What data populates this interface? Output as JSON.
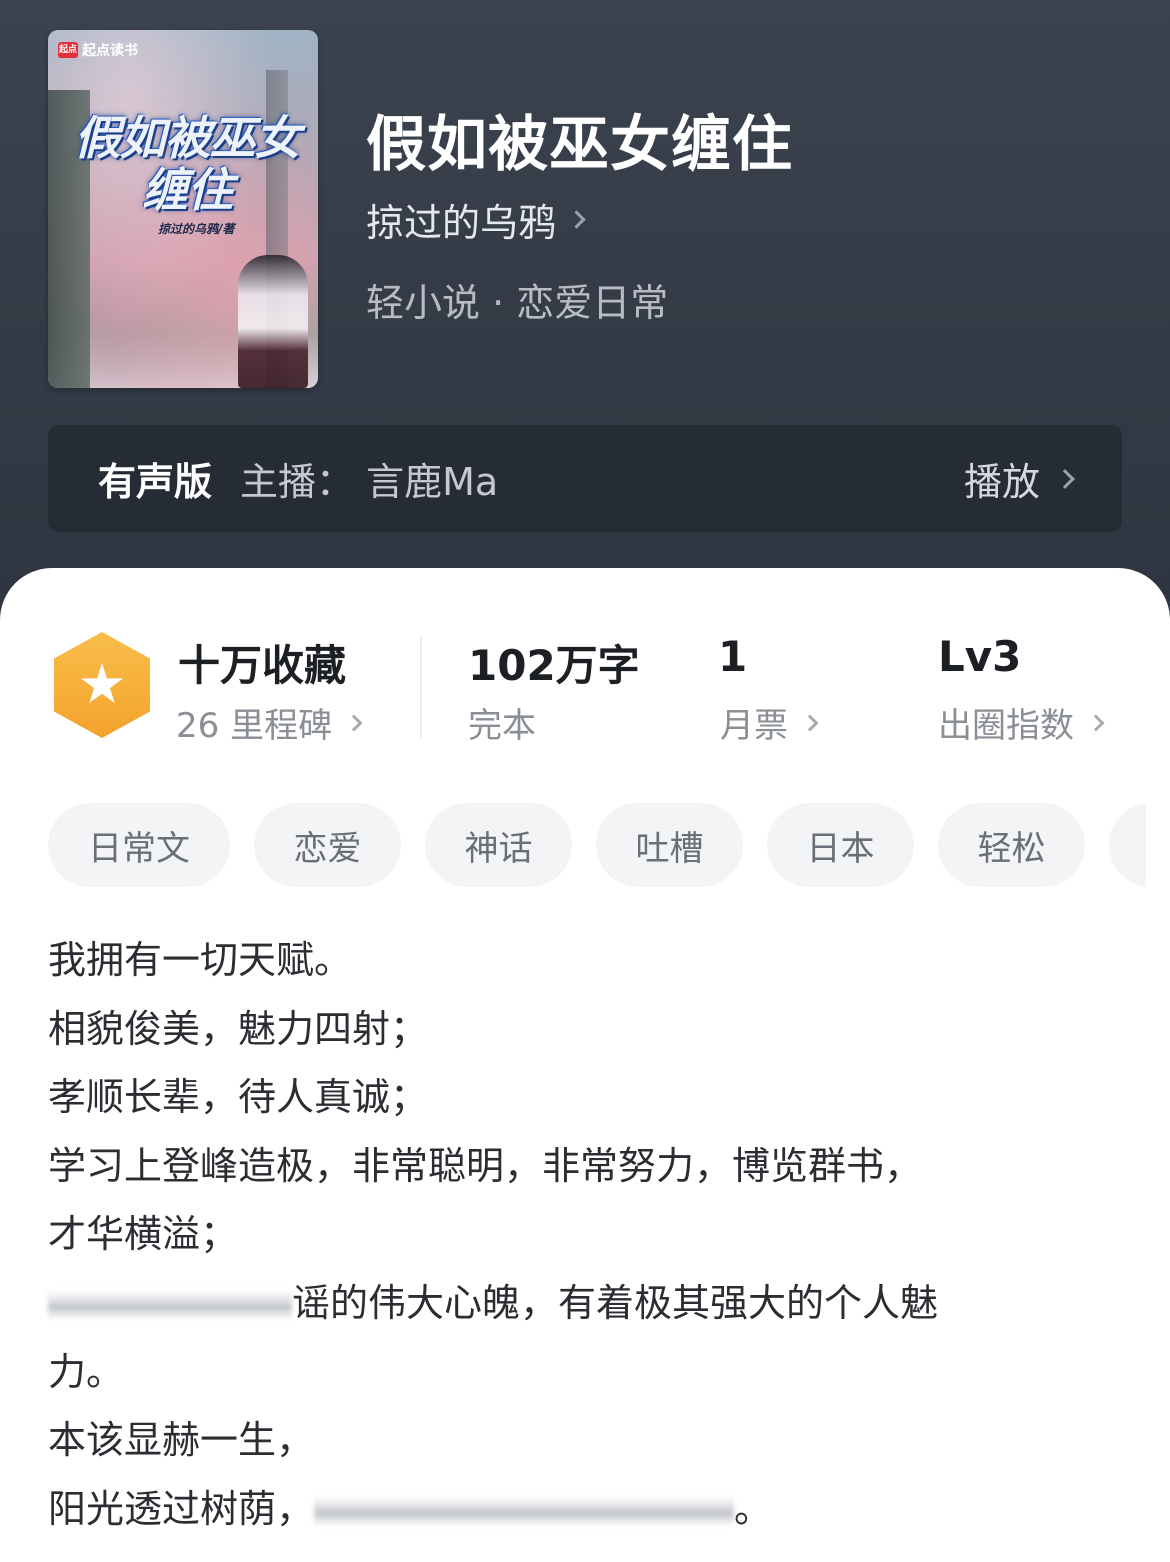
{
  "book": {
    "cover_badge": "起点读书",
    "cover_badge_logo": "起点",
    "cover_title": "假如被巫女缠住",
    "cover_author": "掠过的乌鸦/著",
    "title": "假如被巫女缠住",
    "author": "掠过的乌鸦",
    "genre": "轻小说 · 恋爱日常"
  },
  "audio": {
    "label": "有声版",
    "host": "主播：  言鹿Ma",
    "play": "播放"
  },
  "stats": {
    "favorites": {
      "main": "十万收藏",
      "sub": "26 里程碑"
    },
    "words": {
      "main": "102万字",
      "sub": "完本"
    },
    "tickets": {
      "main": "1",
      "sub": "月票"
    },
    "level": {
      "main": "Lv3",
      "sub": "出圈指数"
    },
    "badge_color": "#f5aa34"
  },
  "tags": [
    "日常文",
    "恋爱",
    "神话",
    "吐槽",
    "日本",
    "轻松"
  ],
  "description": {
    "l1": "我拥有一切天赋。",
    "l2": "相貌俊美，魅力四射；",
    "l3": "孝顺长辈，待人真诚；",
    "l4": "学习上登峰造极，非常聪明，非常努力，博览群书，",
    "l5": "才华横溢；",
    "l6": "谣的伟大心魄，有着极其强大的个人魅",
    "l7": "力。",
    "l8": "本该显赫一生，",
    "l9a": "阳光透过树荫，",
    "l9b": "。"
  }
}
